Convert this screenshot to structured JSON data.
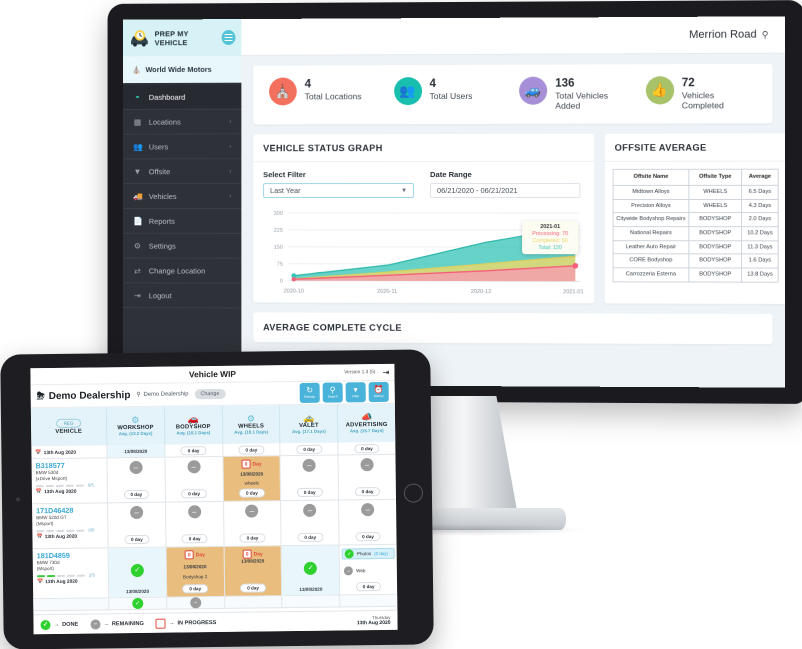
{
  "desktop": {
    "brand": {
      "name": "PREP MY VEHICLE",
      "logo_icon": "car-clock-logo",
      "menu_icon": "hamburger-icon"
    },
    "organisation": {
      "label": "World Wide Motors",
      "icon": "home-icon"
    },
    "nav": [
      {
        "label": "Dashboard",
        "icon": "dashboard-icon",
        "active": true,
        "chevron": ""
      },
      {
        "label": "Locations",
        "icon": "building-icon",
        "active": false,
        "chevron": "›"
      },
      {
        "label": "Users",
        "icon": "users-icon",
        "active": false,
        "chevron": "›"
      },
      {
        "label": "Offsite",
        "icon": "sitemap-icon",
        "active": false,
        "chevron": "›"
      },
      {
        "label": "Vehicles",
        "icon": "truck-icon",
        "active": false,
        "chevron": "›"
      },
      {
        "label": "Reports",
        "icon": "file-icon",
        "active": false,
        "chevron": ""
      },
      {
        "label": "Settings",
        "icon": "gear-icon",
        "active": false,
        "chevron": ""
      },
      {
        "label": "Change Location",
        "icon": "exchange-icon",
        "active": false,
        "chevron": ""
      },
      {
        "label": "Logout",
        "icon": "logout-icon",
        "active": false,
        "chevron": ""
      }
    ],
    "topbar": {
      "location": "Merrion Road",
      "pin_icon": "map-pin-icon"
    },
    "stats": [
      {
        "value": "4",
        "label": "Total Locations",
        "icon": "home-icon",
        "color": "#f4705e"
      },
      {
        "value": "4",
        "label": "Total Users",
        "icon": "users-icon",
        "color": "#18bfae"
      },
      {
        "value": "136",
        "label": "Total Vehicles Added",
        "icon": "van-icon",
        "color": "#a68fd6"
      },
      {
        "value": "72",
        "label": "Vehicles Completed",
        "icon": "thumbs-up-icon",
        "color": "#a8c26a"
      }
    ],
    "graph": {
      "title": "VEHICLE STATUS GRAPH",
      "filter_label": "Select Filter",
      "filter_value": "Last Year",
      "date_label": "Date Range",
      "date_value": "06/21/2020 - 06/21/2021",
      "tooltip": {
        "title": "2021-01",
        "processing": "Processing: 70",
        "completed": "Completed: 50",
        "total": "Total: 120"
      }
    },
    "offsite": {
      "title": "OFFSITE AVERAGE",
      "columns": [
        "Offsite Name",
        "Offsite Type",
        "Average"
      ],
      "rows": [
        [
          "Midtown Alloys",
          "WHEELS",
          "6.5 Days"
        ],
        [
          "Precision Alloys",
          "WHEELS",
          "4.3 Days"
        ],
        [
          "Citywide Bodyshop Repairs",
          "BODYSHOP",
          "2.0 Days"
        ],
        [
          "National Repairs",
          "BODYSHOP",
          "10.2 Days"
        ],
        [
          "Leather Auto Repair",
          "BODYSHOP",
          "11.3 Days"
        ],
        [
          "CORE Bodyshop",
          "BODYSHOP",
          "1.6 Days"
        ],
        [
          "Carrozzeria Esterna",
          "BODYSHOP",
          "13.8 Days"
        ]
      ]
    },
    "bottom_panel_title": "AVERAGE COMPLETE CYCLE"
  },
  "chart_data": {
    "type": "area",
    "title": "VEHICLE STATUS GRAPH",
    "x": [
      "2020-10",
      "2020-11",
      "2020-12",
      "2021-01"
    ],
    "series": [
      {
        "name": "Total",
        "values": [
          22,
          70,
          170,
          240
        ],
        "color": "#34c3b5"
      },
      {
        "name": "Completed",
        "values": [
          8,
          40,
          75,
          110
        ],
        "color": "#e6d96f"
      },
      {
        "name": "Processing",
        "values": [
          6,
          25,
          45,
          68
        ],
        "color": "#f4607a"
      }
    ],
    "ylim": [
      0,
      300
    ],
    "yticks": [
      0,
      75,
      150,
      225,
      300
    ],
    "xlabel": "",
    "ylabel": "",
    "grid": true,
    "legend": "none"
  },
  "tablet": {
    "title": "Vehicle WIP",
    "version": "Version 1.3 (5)",
    "logout_icon": "logout-icon",
    "dealership": "Demo Dealership",
    "location": "Demo Dealership",
    "change_label": "Change",
    "actions": [
      {
        "label": "Refresh",
        "icon": "refresh-icon"
      },
      {
        "label": "Search",
        "icon": "search-icon"
      },
      {
        "label": "Filter",
        "icon": "filter-icon"
      },
      {
        "label": "History",
        "icon": "history-icon"
      }
    ],
    "columns": [
      {
        "name": "VEHICLE",
        "avg": "",
        "pill": "REG",
        "icon": "reg-plate-icon"
      },
      {
        "name": "WORKSHOP",
        "avg": "Avg. (13.2 Days)",
        "icon": "gear-icon"
      },
      {
        "name": "BODYSHOP",
        "avg": "Avg. (18.1 Days)",
        "icon": "car-icon"
      },
      {
        "name": "WHEELS",
        "avg": "Avg. (18.1 Days)",
        "icon": "wheel-icon"
      },
      {
        "name": "VALET",
        "avg": "Avg. (17.1 Days)",
        "icon": "car-wash-icon"
      },
      {
        "name": "ADVERTISING",
        "avg": "Avg. (15.7 Days)",
        "icon": "megaphone-icon"
      }
    ],
    "rows": [
      {
        "reg": "",
        "model": "",
        "sub": "",
        "progress": 0,
        "progress_total": 5,
        "date": "13th Aug 2020",
        "partial": true,
        "cells": [
          {
            "type": "text",
            "text": "13/08/2020",
            "day": "",
            "bg": "blue"
          },
          {
            "type": "day",
            "day": "0 day",
            "bg": "white"
          },
          {
            "type": "day",
            "day": "0 day",
            "bg": "white"
          },
          {
            "type": "day",
            "day": "0 day",
            "bg": "white"
          },
          {
            "type": "day",
            "day": "0 day",
            "bg": "white"
          }
        ]
      },
      {
        "reg": "B318577",
        "model": "BMW 530d",
        "sub": "(xDrive Msport)",
        "progress": 0,
        "progress_total": 5,
        "date": "13th Aug 2020",
        "cells": [
          {
            "type": "status",
            "status": "remaining",
            "day": "0 day",
            "bg": "white"
          },
          {
            "type": "status",
            "status": "remaining",
            "day": "0 day",
            "bg": "white"
          },
          {
            "type": "offsite",
            "cal": "0",
            "cal_label": "Day",
            "date": "13/08/2020",
            "note": "wheels",
            "day": "0 day",
            "bg": "amber"
          },
          {
            "type": "status",
            "status": "remaining",
            "day": "0 day",
            "bg": "white"
          },
          {
            "type": "status",
            "status": "remaining",
            "day": "0 day",
            "bg": "white"
          }
        ]
      },
      {
        "reg": "171D46428",
        "model": "BMW 520d GT",
        "sub": "(Msport)",
        "progress": 0,
        "progress_total": 5,
        "date": "13th Aug 2020",
        "cells": [
          {
            "type": "status",
            "status": "remaining",
            "day": "0 day",
            "bg": "white"
          },
          {
            "type": "status",
            "status": "remaining",
            "day": "0 day",
            "bg": "white"
          },
          {
            "type": "status",
            "status": "remaining",
            "day": "0 day",
            "bg": "white"
          },
          {
            "type": "status",
            "status": "remaining",
            "day": "0 day",
            "bg": "white"
          },
          {
            "type": "status",
            "status": "remaining",
            "day": "0 day",
            "bg": "white"
          }
        ]
      },
      {
        "reg": "181D4859",
        "model": "BMW 730d",
        "sub": "(Msport)",
        "progress": 2,
        "progress_total": 5,
        "date": "13th Aug 2020",
        "cells": [
          {
            "type": "done",
            "status": "done",
            "text": "13/08/2020",
            "bg": "blue"
          },
          {
            "type": "offsite",
            "cal": "0",
            "cal_label": "Day",
            "date": "13/08/2020",
            "note": "Bodyshop 2",
            "day": "0 day",
            "bg": "amber"
          },
          {
            "type": "offsite",
            "cal": "0",
            "cal_label": "Day",
            "date": "13/08/2020",
            "note": "",
            "day": "0 day",
            "bg": "amber"
          },
          {
            "type": "done",
            "status": "done",
            "text": "13/08/2020",
            "bg": "blue"
          },
          {
            "type": "adv",
            "items": [
              {
                "status": "done",
                "label": "Photos",
                "day": "(0 day)"
              },
              {
                "status": "remaining",
                "label": "Web",
                "day": ""
              }
            ],
            "day": "0 day",
            "bg": "white"
          }
        ]
      }
    ],
    "legend": [
      {
        "label": "DONE",
        "icon": "check-circle-icon"
      },
      {
        "label": "REMAINING",
        "icon": "dash-circle-icon"
      },
      {
        "label": "IN PROGRESS",
        "icon": "calendar-icon"
      }
    ],
    "today": {
      "weekday": "Thursday",
      "date": "13th Aug 2020"
    }
  }
}
